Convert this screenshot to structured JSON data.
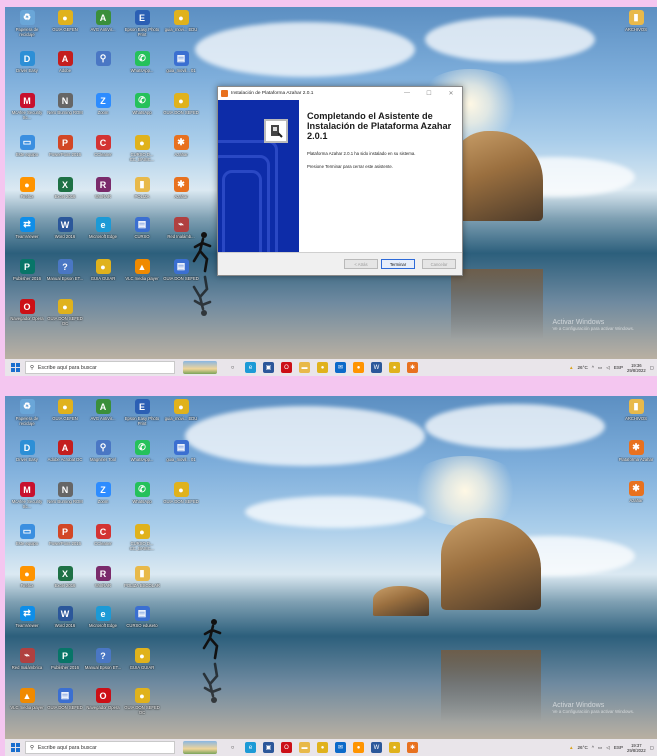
{
  "screen1": {
    "left_icons": [
      {
        "label": "Papelera de reciclaje",
        "icon": "recycle-bin-icon",
        "color": "#6aa6d8"
      },
      {
        "label": "GUIA GEFEN",
        "icon": "chrome-icon",
        "color": "#e0b21c"
      },
      {
        "label": "AVG AntiVir...",
        "icon": "avg-icon",
        "color": "#3a8f3a"
      },
      {
        "label": "Epson Easy Photo Print",
        "icon": "epson-icon",
        "color": "#2b5fb4"
      },
      {
        "label": "guia_movi... EDU",
        "icon": "chrome-icon",
        "color": "#e0b21c"
      },
      {
        "label": "Driver Easy",
        "icon": "driver-easy-icon",
        "color": "#2d8fd6"
      },
      {
        "label": "Adobe",
        "icon": "adobe-icon",
        "color": "#c41e1e"
      },
      {
        "label": "",
        "icon": "magnifier-icon",
        "color": "#4a77c4"
      },
      {
        "label": "WhatsApp...",
        "icon": "whatsapp-icon",
        "color": "#25c15b"
      },
      {
        "label": "guia_movil... 01",
        "icon": "document-icon",
        "color": "#3b6fd1"
      },
      {
        "label": "McAfee Security Sc...",
        "icon": "mcafee-icon",
        "color": "#c8102e"
      },
      {
        "label": "Nero Burning ROM",
        "icon": "nero-icon",
        "color": "#666666"
      },
      {
        "label": "Zoom",
        "icon": "zoom-icon",
        "color": "#2d8cff"
      },
      {
        "label": "WhatsApp",
        "icon": "whatsapp-icon",
        "color": "#25c15b"
      },
      {
        "label": "GUIA DON SEFED",
        "icon": "chrome-icon",
        "color": "#e0b21c"
      },
      {
        "label": "Este equipo",
        "icon": "this-pc-icon",
        "color": "#3b8fe0"
      },
      {
        "label": "PowerPoint 2016",
        "icon": "powerpoint-icon",
        "color": "#d24726"
      },
      {
        "label": "CCleaner",
        "icon": "ccleaner-icon",
        "color": "#d33333"
      },
      {
        "label": "CURSO D... CC_BASIC...",
        "icon": "chrome-icon",
        "color": "#e0b21c"
      },
      {
        "label": "Azahar",
        "icon": "azahar-icon",
        "color": "#e8711f"
      },
      {
        "label": "Firefox",
        "icon": "firefox-icon",
        "color": "#ff9400"
      },
      {
        "label": "Excel 2016",
        "icon": "excel-icon",
        "color": "#1e7145"
      },
      {
        "label": "WinRAR",
        "icon": "winrar-icon",
        "color": "#7a2b6b"
      },
      {
        "label": "POLIZA",
        "icon": "folder-icon",
        "color": "#e8b94a"
      },
      {
        "label": "Azahar",
        "icon": "azahar-icon",
        "color": "#e8711f"
      },
      {
        "label": "TeamViewer",
        "icon": "teamviewer-icon",
        "color": "#0e8ee9"
      },
      {
        "label": "Word 2016",
        "icon": "word-icon",
        "color": "#2b579a"
      },
      {
        "label": "Microsoft Edge",
        "icon": "edge-icon",
        "color": "#1c9ad6"
      },
      {
        "label": "CURSO",
        "icon": "document-icon",
        "color": "#3b6fd1"
      },
      {
        "label": "Red Inalámb...",
        "icon": "network-icon",
        "color": "#b04040"
      },
      {
        "label": "Publisher 2016",
        "icon": "publisher-icon",
        "color": "#077568"
      },
      {
        "label": "Manual Epson ET...",
        "icon": "manual-icon",
        "color": "#4a77c4"
      },
      {
        "label": "GUIA GUIAR",
        "icon": "chrome-icon",
        "color": "#e0b21c"
      },
      {
        "label": "VLC media player",
        "icon": "vlc-icon",
        "color": "#f08a00"
      },
      {
        "label": "GUIA DON SEFED",
        "icon": "document-icon",
        "color": "#3b6fd1"
      },
      {
        "label": "Navegador Opera",
        "icon": "opera-icon",
        "color": "#cc0f16"
      },
      {
        "label": "GUIA DON SEFED OC",
        "icon": "chrome-icon",
        "color": "#e0b21c"
      }
    ],
    "right_icons": [
      {
        "label": "ARCHIVOS",
        "icon": "folder-icon",
        "color": "#e8b94a"
      }
    ],
    "dialog": {
      "title": "Instalación de Plataforma Azahar 2.0.1",
      "heading": "Completando el Asistente de Instalación de Plataforma Azahar 2.0.1",
      "line1": "Plataforma Azahar 2.0.1 ha sido instalado en su sistema.",
      "line2": "Presione Terminar para cerrar este asistente.",
      "back_label": "< Atrás",
      "finish_label": "Terminar",
      "cancel_label": "Cancelar"
    },
    "watermark": {
      "title": "Activar Windows",
      "subtitle": "Ve a Configuración para activar Windows."
    },
    "taskbar": {
      "search_placeholder": "Escribe aquí para buscar",
      "weather": "26°C",
      "lang": "ESP",
      "time": "19:36",
      "date": "29/8/2022"
    }
  },
  "screen2": {
    "left_icons": [
      {
        "label": "Papelera de reciclaje",
        "icon": "recycle-bin-icon",
        "color": "#6aa6d8"
      },
      {
        "label": "GUIA GEFEN",
        "icon": "chrome-icon",
        "color": "#e0b21c"
      },
      {
        "label": "AVG AntiVir...",
        "icon": "avg-icon",
        "color": "#3a8f3a"
      },
      {
        "label": "Epson Easy Photo Print",
        "icon": "epson-icon",
        "color": "#2b5fb4"
      },
      {
        "label": "guia_movi... EDU",
        "icon": "chrome-icon",
        "color": "#e0b21c"
      },
      {
        "label": "Driver Easy",
        "icon": "driver-easy-icon",
        "color": "#2d8fd6"
      },
      {
        "label": "Adobe Acrobat DC",
        "icon": "adobe-icon",
        "color": "#c41e1e"
      },
      {
        "label": "Magnifier Tool",
        "icon": "magnifier-icon",
        "color": "#4a77c4"
      },
      {
        "label": "WhatsApp...",
        "icon": "whatsapp-icon",
        "color": "#25c15b"
      },
      {
        "label": "guia_movil... 01",
        "icon": "document-icon",
        "color": "#3b6fd1"
      },
      {
        "label": "McAfee Security Sc...",
        "icon": "mcafee-icon",
        "color": "#c8102e"
      },
      {
        "label": "Nero Burning ROM",
        "icon": "nero-icon",
        "color": "#666666"
      },
      {
        "label": "Zoom",
        "icon": "zoom-icon",
        "color": "#2d8cff"
      },
      {
        "label": "WhatsApp",
        "icon": "whatsapp-icon",
        "color": "#25c15b"
      },
      {
        "label": "GUIA DON SEFED",
        "icon": "chrome-icon",
        "color": "#e0b21c"
      },
      {
        "label": "Este equipo",
        "icon": "this-pc-icon",
        "color": "#3b8fe0"
      },
      {
        "label": "PowerPoint 2016",
        "icon": "powerpoint-icon",
        "color": "#d24726"
      },
      {
        "label": "CCleaner",
        "icon": "ccleaner-icon",
        "color": "#d33333"
      },
      {
        "label": "CURSO D... CC_BASIC...",
        "icon": "chrome-icon",
        "color": "#e0b21c"
      },
      {
        "label": "",
        "icon": "blank-icon",
        "color": "transparent"
      },
      {
        "label": "Firefox",
        "icon": "firefox-icon",
        "color": "#ff9400"
      },
      {
        "label": "Excel 2016",
        "icon": "excel-icon",
        "color": "#1e7145"
      },
      {
        "label": "WinRAR",
        "icon": "winrar-icon",
        "color": "#7a2b6b"
      },
      {
        "label": "POLIZA ESCOLAR",
        "icon": "folder-icon",
        "color": "#e8b94a"
      },
      {
        "label": "",
        "icon": "blank-icon",
        "color": "transparent"
      },
      {
        "label": "TeamViewer",
        "icon": "teamviewer-icon",
        "color": "#0e8ee9"
      },
      {
        "label": "Word 2016",
        "icon": "word-icon",
        "color": "#2b579a"
      },
      {
        "label": "Microsoft Edge",
        "icon": "edge-icon",
        "color": "#1c9ad6"
      },
      {
        "label": "CURSO eduseto",
        "icon": "document-icon",
        "color": "#3b6fd1"
      },
      {
        "label": "",
        "icon": "blank-icon",
        "color": "transparent"
      },
      {
        "label": "Red Inalámbrica",
        "icon": "network-icon",
        "color": "#b04040"
      },
      {
        "label": "Publisher 2016",
        "icon": "publisher-icon",
        "color": "#077568"
      },
      {
        "label": "Manual Epson ET...",
        "icon": "manual-icon",
        "color": "#4a77c4"
      },
      {
        "label": "GUIA GUIAR",
        "icon": "chrome-icon",
        "color": "#e0b21c"
      },
      {
        "label": "",
        "icon": "blank-icon",
        "color": "transparent"
      },
      {
        "label": "VLC media player",
        "icon": "vlc-icon",
        "color": "#f08a00"
      },
      {
        "label": "GUIA DON SEFED",
        "icon": "document-icon",
        "color": "#3b6fd1"
      },
      {
        "label": "Navegador Opera",
        "icon": "opera-icon",
        "color": "#cc0f16"
      },
      {
        "label": "GUIA DON SEFED OC",
        "icon": "chrome-icon",
        "color": "#e0b21c"
      }
    ],
    "right_icons": [
      {
        "label": "ARCHIVOS",
        "icon": "folder-icon",
        "color": "#e8b94a"
      },
      {
        "label": "Plataforma Azahar",
        "icon": "azahar-icon",
        "color": "#e8711f"
      },
      {
        "label": "Azahar",
        "icon": "azahar-icon",
        "color": "#e8711f"
      }
    ],
    "watermark": {
      "title": "Activar Windows",
      "subtitle": "Ve a Configuración para activar Windows."
    },
    "taskbar": {
      "search_placeholder": "Escribe aquí para buscar",
      "weather": "26°C",
      "lang": "ESP",
      "time": "19:37",
      "date": "29/8/2022"
    }
  },
  "taskbar_apps": [
    {
      "icon": "task-view-icon",
      "color": "#555555",
      "glyph": "○"
    },
    {
      "icon": "edge-icon",
      "color": "#1c9ad6",
      "glyph": "e"
    },
    {
      "icon": "store-icon",
      "color": "#2b579a",
      "glyph": "▣"
    },
    {
      "icon": "opera-icon",
      "color": "#cc0f16",
      "glyph": "O"
    },
    {
      "icon": "file-explorer-icon",
      "color": "#e8b94a",
      "glyph": "▬"
    },
    {
      "icon": "chrome-icon",
      "color": "#e0b21c",
      "glyph": "●"
    },
    {
      "icon": "mail-icon",
      "color": "#0c6ac9",
      "glyph": "✉"
    },
    {
      "icon": "firefox-icon",
      "color": "#ff9400",
      "glyph": "●"
    },
    {
      "icon": "word-icon",
      "color": "#2b579a",
      "glyph": "W"
    },
    {
      "icon": "chrome-icon",
      "color": "#e0b21c",
      "glyph": "●"
    },
    {
      "icon": "azahar-icon",
      "color": "#e8711f",
      "glyph": "✱"
    }
  ]
}
